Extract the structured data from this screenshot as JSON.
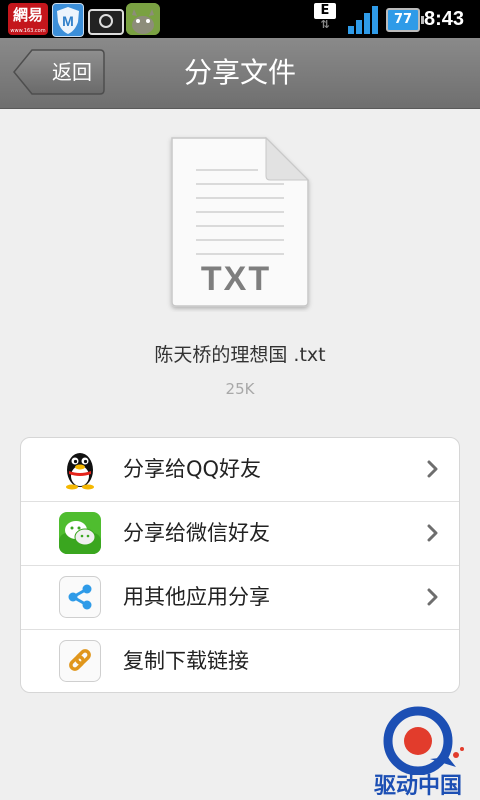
{
  "status_bar": {
    "netease_label": "網易",
    "netease_sub": "www.163.com",
    "network_type": "E",
    "battery_level": "77",
    "time": "8:43"
  },
  "header": {
    "back_label": "返回",
    "title": "分享文件"
  },
  "file": {
    "type_label": "TXT",
    "name": "陈天桥的理想国 .txt",
    "size": "25K"
  },
  "share_options": [
    {
      "label": "分享给QQ好友",
      "icon": "qq-penguin-icon"
    },
    {
      "label": "分享给微信好友",
      "icon": "wechat-icon"
    },
    {
      "label": "用其他应用分享",
      "icon": "share-icon"
    },
    {
      "label": "复制下载链接",
      "icon": "link-icon"
    }
  ],
  "watermark": {
    "text": "驱动中国"
  },
  "colors": {
    "header_bg": "#7c7c7c",
    "page_bg": "#efefef",
    "accent_blue": "#2f9be8"
  }
}
